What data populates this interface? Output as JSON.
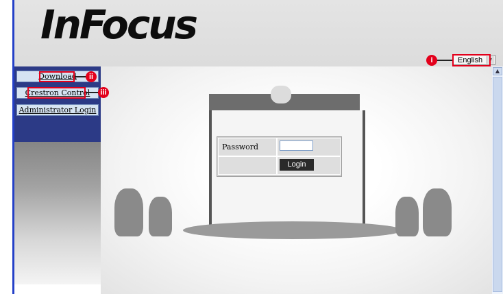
{
  "header": {
    "logo_text": "InFocus",
    "language": "English"
  },
  "sidebar": {
    "items": [
      {
        "label": "Download"
      },
      {
        "label": "Crestron Control"
      },
      {
        "label": "Administrator Login"
      }
    ]
  },
  "login": {
    "password_label": "Password",
    "password_value": "",
    "login_button": "Login"
  },
  "callouts": {
    "language": "i",
    "download": "ii",
    "crestron": "iii"
  },
  "colors": {
    "callout_red": "#e3001b",
    "sidebar_dark": "#2c3a86",
    "button_bg": "#d6e3f2",
    "login_button_bg": "#2a2a2a"
  },
  "icons": {
    "language_dropdown": "chevron-down-icon",
    "scroll_up": "chevron-up-icon"
  }
}
